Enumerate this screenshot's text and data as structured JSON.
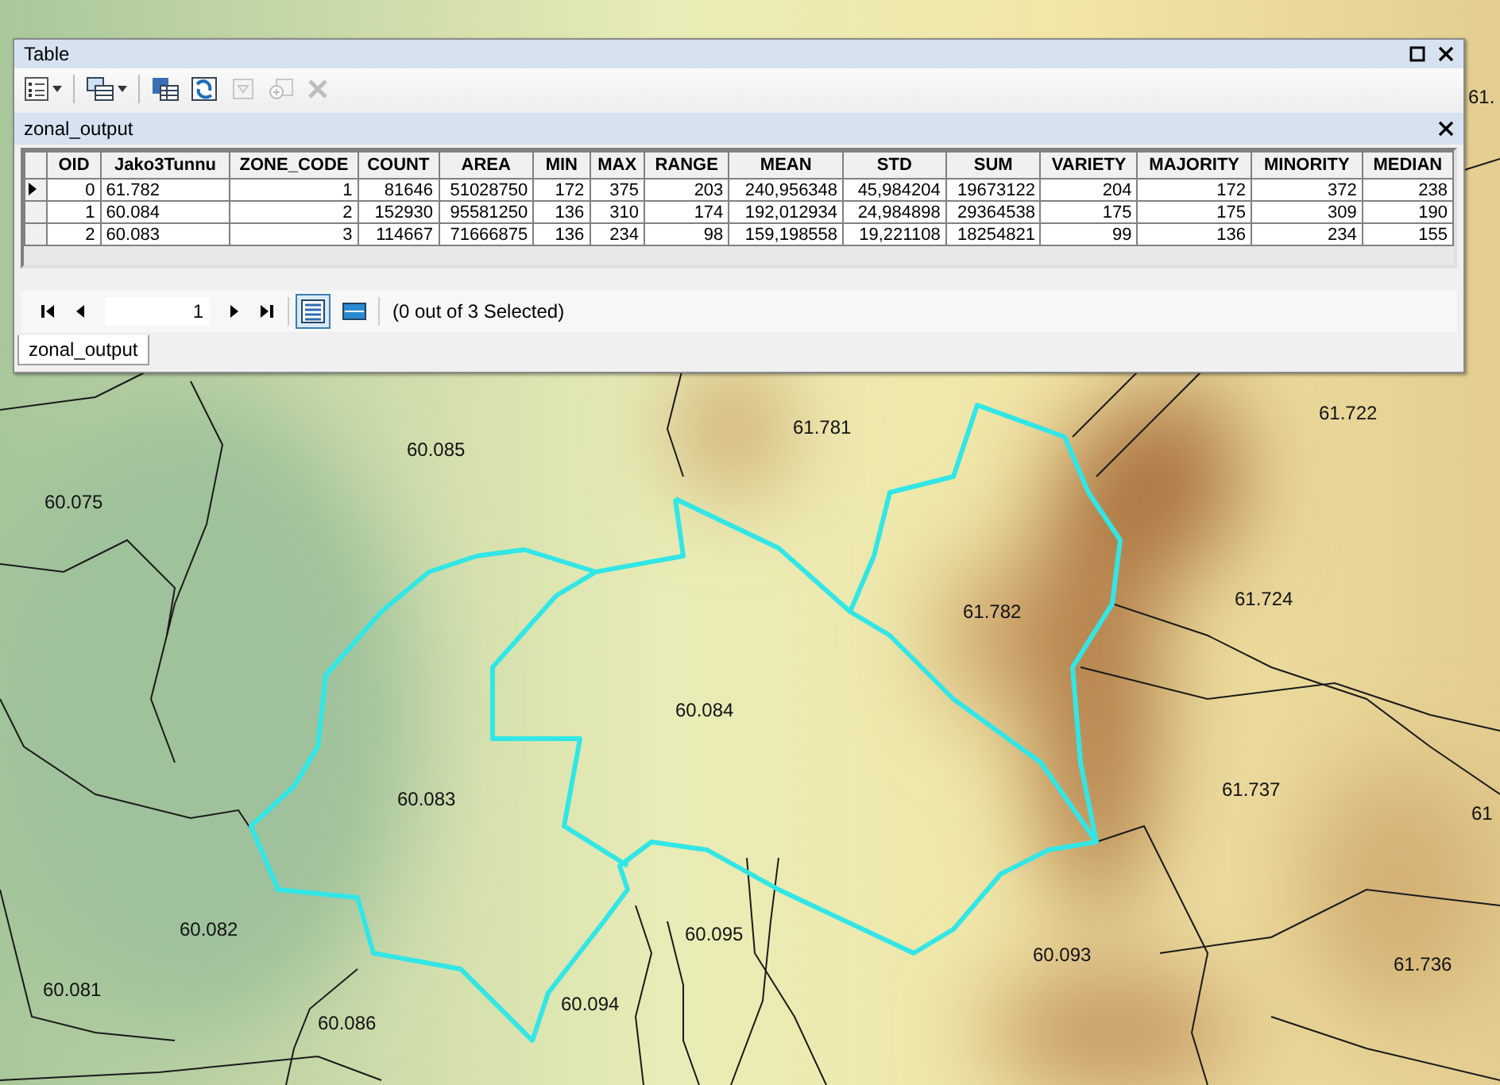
{
  "window": {
    "title": "Table"
  },
  "toolbar": [
    {
      "kind": "dropdown",
      "disabled": false
    },
    {
      "kind": "dropdown",
      "disabled": false
    },
    {
      "kind": "button",
      "disabled": false
    },
    {
      "kind": "button",
      "disabled": false
    },
    {
      "kind": "button",
      "disabled": true
    },
    {
      "kind": "button",
      "disabled": true
    },
    {
      "kind": "button",
      "disabled": true
    }
  ],
  "table": {
    "name": "zonal_output",
    "columns": [
      "OID",
      "Jako3Tunnu",
      "ZONE_CODE",
      "COUNT",
      "AREA",
      "MIN",
      "MAX",
      "RANGE",
      "MEAN",
      "STD",
      "SUM",
      "VARIETY",
      "MAJORITY",
      "MINORITY",
      "MEDIAN"
    ],
    "rows": [
      {
        "current": true,
        "cells": [
          "0",
          "61.782",
          "1",
          "81646",
          "51028750",
          "172",
          "375",
          "203",
          "240,956348",
          "45,984204",
          "19673122",
          "204",
          "172",
          "372",
          "238"
        ]
      },
      {
        "current": false,
        "cells": [
          "1",
          "60.084",
          "2",
          "152930",
          "95581250",
          "136",
          "310",
          "174",
          "192,012934",
          "24,984898",
          "29364538",
          "175",
          "175",
          "309",
          "190"
        ]
      },
      {
        "current": false,
        "cells": [
          "2",
          "60.083",
          "3",
          "114667",
          "71666875",
          "136",
          "234",
          "98",
          "159,198558",
          "19,221108",
          "18254821",
          "99",
          "136",
          "234",
          "155"
        ]
      }
    ]
  },
  "navigator": {
    "record": "1",
    "views": [
      {
        "kind": "all",
        "selected": true
      },
      {
        "kind": "selected",
        "selected": false
      }
    ],
    "selection_status": "(0 out of 3 Selected)"
  },
  "tabs": [
    {
      "label": "zonal_output",
      "selected": true
    }
  ],
  "map": {
    "labels": [
      "61.",
      "60.085",
      "61.781",
      "61.722",
      "60.075",
      "61.782",
      "61.724",
      "60.084",
      "60.083",
      "61.737",
      "61",
      "60.082",
      "60.095",
      "60.093",
      "61.736",
      "60.081",
      "60.094",
      "60.086"
    ]
  }
}
